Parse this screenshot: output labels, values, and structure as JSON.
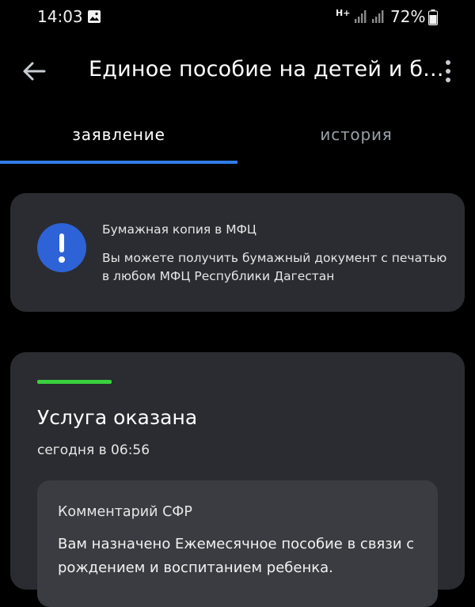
{
  "status_bar": {
    "time": "14:03",
    "network": "H+",
    "battery": "72%"
  },
  "app_bar": {
    "title": "Единое пособие на детей и б...",
    "back_icon": "arrow-left-icon",
    "menu_icon": "more-vertical-icon"
  },
  "tabs": [
    {
      "label": "заявление",
      "active": true
    },
    {
      "label": "история",
      "active": false
    }
  ],
  "notice": {
    "icon": "exclamation-icon",
    "title": "Бумажная копия в МФЦ",
    "text": "Вы можете получить бумажный документ с печатью в любом МФЦ Республики Дагестан"
  },
  "status": {
    "title": "Услуга оказана",
    "time": "сегодня в 06:56",
    "accent_color": "#3ad13e",
    "comment": {
      "title": "Комментарий СФР",
      "text": "Вам назначено Ежемесячное пособие в связи с рождением и воспитанием ребенка."
    }
  },
  "colors": {
    "background": "#000000",
    "card": "#2a2c31",
    "accent": "#2f7ce6"
  }
}
